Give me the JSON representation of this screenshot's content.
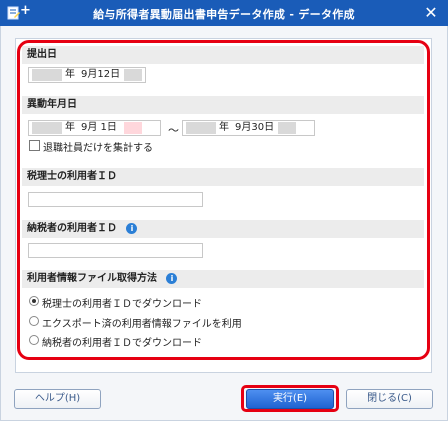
{
  "window": {
    "title": "給与所得者異動届出書申告データ作成 - データ作成",
    "close_glyph": "✕"
  },
  "sections": {
    "submit_date": {
      "label": "提出日",
      "era_suffix": "年",
      "value": "9月12日"
    },
    "change_period": {
      "label": "異動年月日",
      "from": {
        "era_suffix": "年",
        "value": "9月  1日"
      },
      "separator": "～",
      "to": {
        "era_suffix": "年",
        "value": "9月30日"
      },
      "retired_only_label": "退職社員だけを集計する",
      "retired_only_checked": false
    },
    "tax_accountant_user_id": {
      "label": "税理士の利用者ＩＤ",
      "value": ""
    },
    "taxpayer_user_id": {
      "label": "納税者の利用者ＩＤ",
      "value": ""
    },
    "user_info_file": {
      "label": "利用者情報ファイル取得方法",
      "options": [
        {
          "label": "税理士の利用者ＩＤでダウンロード",
          "selected": true
        },
        {
          "label": "エクスポート済の利用者情報ファイルを利用",
          "selected": false
        },
        {
          "label": "納税者の利用者ＩＤでダウンロード",
          "selected": false
        }
      ]
    }
  },
  "buttons": {
    "help": "ヘルプ(H)",
    "execute": "実行(E)",
    "close": "閉じる(C)"
  },
  "colors": {
    "titlebar": "#1a5cb8",
    "highlight": "#e60012",
    "primary_button": "#2b6fe0",
    "info_icon": "#2b7fd6"
  },
  "icons": {
    "app": "document-pen-icon",
    "info": "info-icon"
  }
}
